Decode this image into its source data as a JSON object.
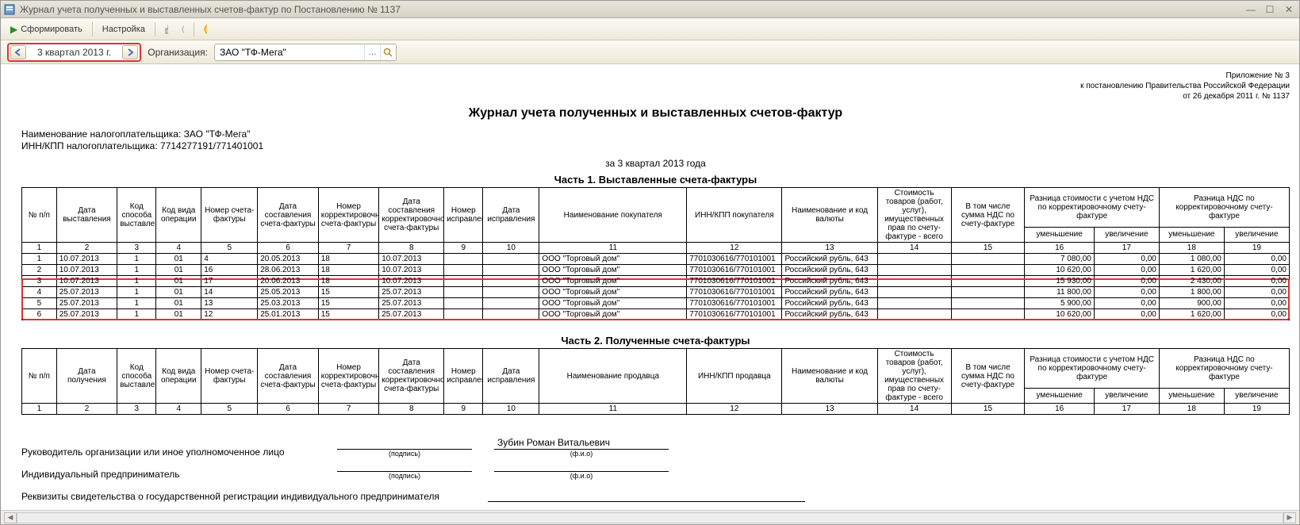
{
  "window": {
    "title": "Журнал учета полученных и выставленных счетов-фактур по Постановлению № 1137"
  },
  "toolbar": {
    "generate": "Сформировать",
    "settings": "Настройка"
  },
  "params": {
    "period": "3 квартал 2013 г.",
    "org_label": "Организация:",
    "org_value": "ЗАО \"ТФ-Мега\""
  },
  "appendix": {
    "l1": "Приложение № 3",
    "l2": "к постановлению Правительства Российской Федерации",
    "l3": "от 26 декабря 2011 г. № 1137"
  },
  "report": {
    "title": "Журнал учета полученных и выставленных счетов-фактур",
    "taxpayer_label": "Наименование налогоплательщика:",
    "taxpayer": "ЗАО \"ТФ-Мега\"",
    "innkpp_label": "ИНН/КПП налогоплательщика:",
    "innkpp": "7714277191/771401001",
    "period_line": "за 3 квартал 2013 года"
  },
  "part1": {
    "title": "Часть 1. Выставленные счета-фактуры",
    "headers_top": [
      "№ п/п",
      "Дата выставления",
      "Код способа выставления",
      "Код вида операции",
      "Номер счета-фактуры",
      "Дата составления счета-фактуры",
      "Номер корректировочного счета-фактуры",
      "Дата составления корректировочного счета-фактуры",
      "Номер исправления",
      "Дата исправления",
      "Наименование покупателя",
      "ИНН/КПП покупателя",
      "Наименование и код валюты",
      "Стоимость товаров (работ, услуг), имущественных прав по счету-фактуре - всего",
      "В том числе сумма НДС по счету-фактуре",
      "Разница стоимости с учетом НДС по корректировочному счету-фактуре",
      "Разница НДС по корректировочному счету-фактуре"
    ],
    "sub16_17": [
      "уменьшение",
      "увеличение"
    ],
    "sub18_19": [
      "уменьшение",
      "увеличение"
    ],
    "colnums": [
      "1",
      "2",
      "3",
      "4",
      "5",
      "6",
      "7",
      "8",
      "9",
      "10",
      "11",
      "12",
      "13",
      "14",
      "15",
      "16",
      "17",
      "18",
      "19"
    ],
    "rows": [
      {
        "n": "1",
        "d": "10.07.2013",
        "c3": "1",
        "c4": "01",
        "c5": "4",
        "c6": "20.05.2013",
        "c7": "18",
        "c8": "10.07.2013",
        "c9": "",
        "c10": "",
        "buyer": "ООО \"Торговый дом\"",
        "inn": "7701030616/770101001",
        "cur": "Российский рубль, 643",
        "c14": "",
        "c15": "",
        "c16": "7 080,00",
        "c17": "0,00",
        "c18": "1 080,00",
        "c19": "0,00"
      },
      {
        "n": "2",
        "d": "10.07.2013",
        "c3": "1",
        "c4": "01",
        "c5": "16",
        "c6": "28.06.2013",
        "c7": "18",
        "c8": "10.07.2013",
        "c9": "",
        "c10": "",
        "buyer": "ООО \"Торговый дом\"",
        "inn": "7701030616/770101001",
        "cur": "Российский рубль, 643",
        "c14": "",
        "c15": "",
        "c16": "10 620,00",
        "c17": "0,00",
        "c18": "1 620,00",
        "c19": "0,00"
      },
      {
        "n": "3",
        "d": "10.07.2013",
        "c3": "1",
        "c4": "01",
        "c5": "17",
        "c6": "20.06.2013",
        "c7": "18",
        "c8": "10.07.2013",
        "c9": "",
        "c10": "",
        "buyer": "ООО \"Торговый дом\"",
        "inn": "7701030616/770101001",
        "cur": "Российский рубль, 643",
        "c14": "",
        "c15": "",
        "c16": "15 930,00",
        "c17": "0,00",
        "c18": "2 430,00",
        "c19": "0,00"
      },
      {
        "n": "4",
        "d": "25.07.2013",
        "c3": "1",
        "c4": "01",
        "c5": "14",
        "c6": "25.05.2013",
        "c7": "15",
        "c8": "25.07.2013",
        "c9": "",
        "c10": "",
        "buyer": "ООО \"Торговый дом\"",
        "inn": "7701030616/770101001",
        "cur": "Российский рубль, 643",
        "c14": "",
        "c15": "",
        "c16": "11 800,00",
        "c17": "0,00",
        "c18": "1 800,00",
        "c19": "0,00"
      },
      {
        "n": "5",
        "d": "25.07.2013",
        "c3": "1",
        "c4": "01",
        "c5": "13",
        "c6": "25.03.2013",
        "c7": "15",
        "c8": "25.07.2013",
        "c9": "",
        "c10": "",
        "buyer": "ООО \"Торговый дом\"",
        "inn": "7701030616/770101001",
        "cur": "Российский рубль, 643",
        "c14": "",
        "c15": "",
        "c16": "5 900,00",
        "c17": "0,00",
        "c18": "900,00",
        "c19": "0,00"
      },
      {
        "n": "6",
        "d": "25.07.2013",
        "c3": "1",
        "c4": "01",
        "c5": "12",
        "c6": "25.01.2013",
        "c7": "15",
        "c8": "25.07.2013",
        "c9": "",
        "c10": "",
        "buyer": "ООО \"Торговый дом\"",
        "inn": "7701030616/770101001",
        "cur": "Российский рубль, 643",
        "c14": "",
        "c15": "",
        "c16": "10 620,00",
        "c17": "0,00",
        "c18": "1 620,00",
        "c19": "0,00"
      }
    ]
  },
  "part2": {
    "title": "Часть 2. Полученные счета-фактуры",
    "headers_top": [
      "№ п/п",
      "Дата получения",
      "Код способа выставления",
      "Код вида операции",
      "Номер счета-фактуры",
      "Дата составления счета-фактуры",
      "Номер корректировочного счета-фактуры",
      "Дата составления корректировочного счета-фактуры",
      "Номер исправления",
      "Дата исправления",
      "Наименование продавца",
      "ИНН/КПП продавца",
      "Наименование и код валюты",
      "Стоимость товаров (работ, услуг), имущественных прав по счету-фактуре - всего",
      "В том числе сумма НДС по счету-фактуре",
      "Разница стоимости с учетом НДС по корректировочному счету-фактуре",
      "Разница НДС по корректировочному счету-фактуре"
    ]
  },
  "signatures": {
    "l1": "Руководитель организации или иное уполномоченное лицо",
    "l2": "Индивидуальный предприниматель",
    "l3": "Реквизиты свидетельства о государственной регистрации индивидуального предпринимателя",
    "podpis": "(подпись)",
    "fio": "(ф.и.о)",
    "manager": "Зубин Роман Витальевич"
  }
}
